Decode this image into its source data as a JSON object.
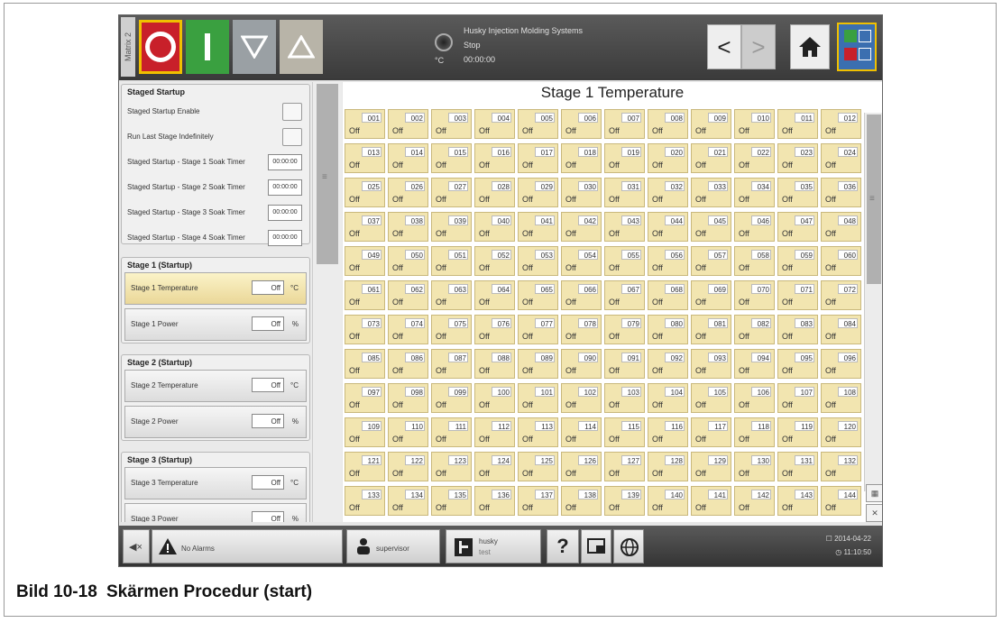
{
  "topbar": {
    "matrix_label": "Matrix 2",
    "status": {
      "line1": "Husky Injection Molding Systems",
      "line2": "Stop",
      "line3": "00:00:00",
      "unit": "°C"
    },
    "nav_prev": "<",
    "nav_next": ">"
  },
  "left_panel": {
    "staged_startup": {
      "title": "Staged Startup",
      "enable_label": "Staged Startup Enable",
      "run_last_label": "Run Last Stage Indefinitely",
      "timers": [
        {
          "label": "Staged Startup - Stage 1 Soak Timer",
          "value": "00:00:00"
        },
        {
          "label": "Staged Startup - Stage 2 Soak Timer",
          "value": "00:00:00"
        },
        {
          "label": "Staged Startup - Stage 3 Soak Timer",
          "value": "00:00:00"
        },
        {
          "label": "Staged Startup - Stage 4 Soak Timer",
          "value": "00:00:00"
        }
      ]
    },
    "stages": [
      {
        "title": "Stage 1 (Startup)",
        "temp_label": "Stage 1 Temperature",
        "temp_value": "Off",
        "temp_unit": "°C",
        "power_label": "Stage 1 Power",
        "power_value": "Off",
        "power_unit": "%"
      },
      {
        "title": "Stage 2 (Startup)",
        "temp_label": "Stage 2 Temperature",
        "temp_value": "Off",
        "temp_unit": "°C",
        "power_label": "Stage 2 Power",
        "power_value": "Off",
        "power_unit": "%"
      },
      {
        "title": "Stage 3 (Startup)",
        "temp_label": "Stage 3 Temperature",
        "temp_value": "Off",
        "temp_unit": "°C",
        "power_label": "Stage 3 Power",
        "power_value": "Off",
        "power_unit": "%"
      }
    ]
  },
  "main": {
    "title": "Stage 1 Temperature",
    "zones": [
      "001",
      "002",
      "003",
      "004",
      "005",
      "006",
      "007",
      "008",
      "009",
      "010",
      "011",
      "012",
      "013",
      "014",
      "015",
      "016",
      "017",
      "018",
      "019",
      "020",
      "021",
      "022",
      "023",
      "024",
      "025",
      "026",
      "027",
      "028",
      "029",
      "030",
      "031",
      "032",
      "033",
      "034",
      "035",
      "036",
      "037",
      "038",
      "039",
      "040",
      "041",
      "042",
      "043",
      "044",
      "045",
      "046",
      "047",
      "048",
      "049",
      "050",
      "051",
      "052",
      "053",
      "054",
      "055",
      "056",
      "057",
      "058",
      "059",
      "060",
      "061",
      "062",
      "063",
      "064",
      "065",
      "066",
      "067",
      "068",
      "069",
      "070",
      "071",
      "072",
      "073",
      "074",
      "075",
      "076",
      "077",
      "078",
      "079",
      "080",
      "081",
      "082",
      "083",
      "084",
      "085",
      "086",
      "087",
      "088",
      "089",
      "090",
      "091",
      "092",
      "093",
      "094",
      "095",
      "096",
      "097",
      "098",
      "099",
      "100",
      "101",
      "102",
      "103",
      "104",
      "105",
      "106",
      "107",
      "108",
      "109",
      "110",
      "111",
      "112",
      "113",
      "114",
      "115",
      "116",
      "117",
      "118",
      "119",
      "120",
      "121",
      "122",
      "123",
      "124",
      "125",
      "126",
      "127",
      "128",
      "129",
      "130",
      "131",
      "132",
      "133",
      "134",
      "135",
      "136",
      "137",
      "138",
      "139",
      "140",
      "141",
      "142",
      "143",
      "144"
    ],
    "zone_status": "Off"
  },
  "bottombar": {
    "alarms": "No Alarms",
    "user": "supervisor",
    "machine_name": "husky",
    "machine_sub": "test",
    "help": "?",
    "date": "2014-04-22",
    "time": "11:10:50"
  },
  "caption": {
    "number": "Bild 10-18",
    "text": "Skärmen Procedur (start)"
  },
  "colors": {
    "cell_fill": "#f2e5b0",
    "stop_red": "#c8202a",
    "start_green": "#3aa040",
    "highlight_yellow": "#f0c000"
  }
}
